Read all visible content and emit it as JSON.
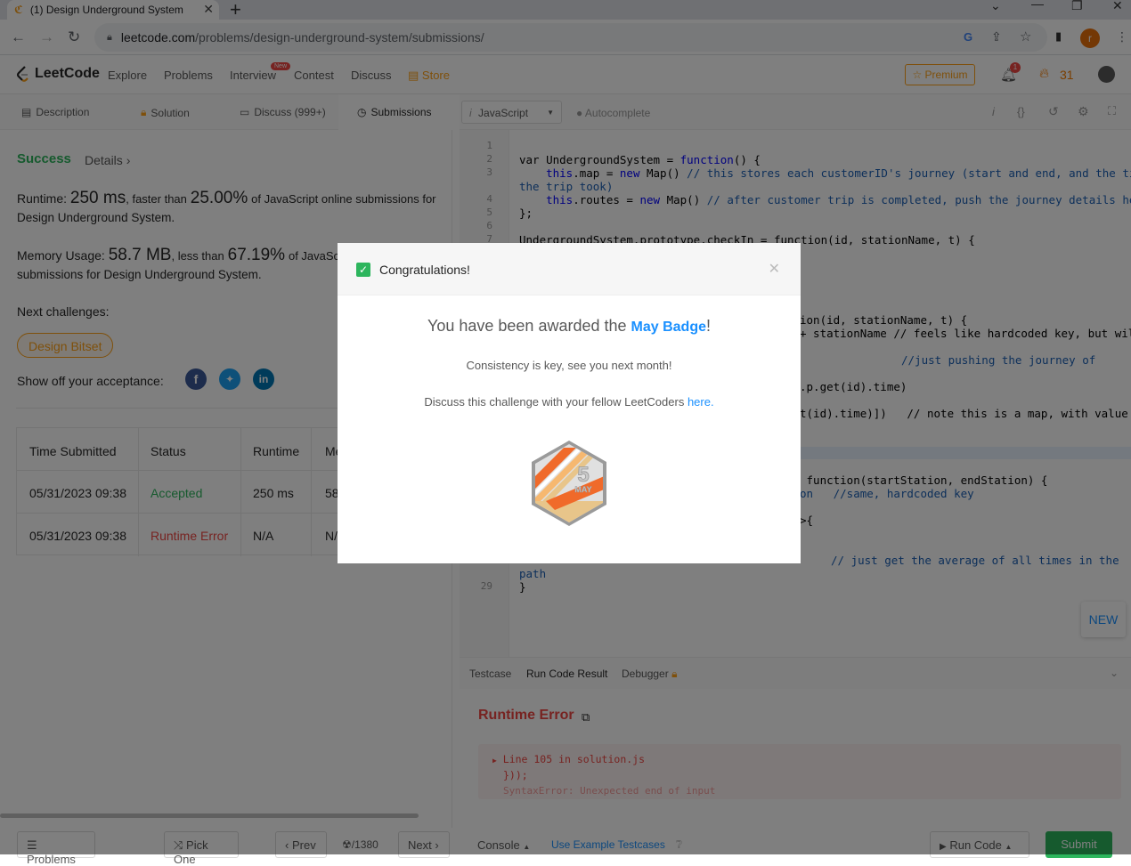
{
  "browser": {
    "tab_title": "(1) Design Underground System",
    "url_host": "leetcode.com",
    "url_path": "/problems/design-underground-system/submissions/",
    "profile_initial": "r"
  },
  "nav": {
    "logo": "LeetCode",
    "links": [
      "Explore",
      "Problems",
      "Interview",
      "Contest",
      "Discuss",
      "Store"
    ],
    "new_badge": "New",
    "premium": "Premium",
    "notif_count": "1",
    "streak": "31"
  },
  "left": {
    "tabs": [
      "Description",
      "Solution",
      "Discuss (999+)",
      "Submissions"
    ],
    "status": "Success",
    "details": "Details",
    "runtime_label": "Runtime:",
    "runtime_value": "250 ms",
    "runtime_mid": ", faster than",
    "runtime_pct": "25.00%",
    "runtime_tail": "of JavaScript online submissions for",
    "runtime_line2": "Design Underground System.",
    "memory_label": "Memory Usage:",
    "memory_value": "58.7 MB",
    "memory_mid": ", less than",
    "memory_pct": "67.19%",
    "memory_tail": "of JavaSc",
    "memory_line2": "submissions for Design Underground System.",
    "next_label": "Next challenges:",
    "next_tag": "Design Bitset",
    "share_label": "Show off your acceptance:",
    "table_headers": [
      "Time Submitted",
      "Status",
      "Runtime",
      "Me"
    ],
    "rows": [
      {
        "time": "05/31/2023 09:38",
        "status": "Accepted",
        "runtime": "250 ms",
        "mem": "58"
      },
      {
        "time": "05/31/2023 09:38",
        "status": "Runtime Error",
        "runtime": "N/A",
        "mem": "N/"
      }
    ]
  },
  "editor": {
    "language": "JavaScript",
    "autocomplete": "Autocomplete",
    "line_numbers": [
      "1",
      "2",
      "3",
      "",
      "4",
      "5",
      "6",
      "7",
      "29"
    ],
    "code": {
      "l2a": "var UndergroundSystem = ",
      "l2b": "function",
      "l2c": "() {",
      "l3a": "    this",
      "l3b": ".map = ",
      "l3c": "new",
      "l3d": " Map() ",
      "l3e": "// this stores each customerID's journey (start and end, and the time",
      "l3f": "the trip took)",
      "l4a": "    this",
      "l4b": ".routes = ",
      "l4c": "new",
      "l4d": " Map() ",
      "l4e": "// after customer trip is completed, push the journey details here",
      "l5": "};",
      "l7": "UndergroundSystem.prototype.checkIn = function(id, stationName, t) {",
      "p1": "ion(id, stationName, t) {",
      "p2": "+ stationName // feels like hardcoded key, but will",
      "p3": "//just pushing the journey of",
      "p4": ".p.get(id).time)",
      "p5": "t(id).time)])   // note this is a map, with value",
      "p6": " function(startStation, endStation) {",
      "p7": "on   //same, hardcoded key",
      "p8": ">{",
      "p9": "// just get the average of all times in the",
      "p10": "path",
      "p11": "}"
    },
    "new_button": "NEW",
    "bottom_tabs": [
      "Testcase",
      "Run Code Result",
      "Debugger"
    ],
    "result_title": "Runtime Error",
    "error_lines": [
      "Line 105 in solution.js",
      "}));",
      "SyntaxError: Unexpected end of input"
    ]
  },
  "footer": {
    "problems": "Problems",
    "pick_one": "Pick One",
    "prev": "Prev",
    "count": "/1380",
    "next": "Next",
    "console": "Console",
    "use_example": "Use Example Testcases",
    "run_code": "Run Code",
    "submit": "Submit"
  },
  "modal": {
    "title": "Congratulations!",
    "award_pre": "You have been awarded the ",
    "award_badge": "May Badge",
    "award_post": "!",
    "consistency": "Consistency is key, see you next month!",
    "discuss_pre": "Discuss this challenge with your fellow LeetCoders ",
    "discuss_link": "here",
    "discuss_post": ".",
    "badge_number": "5",
    "badge_month": "MAY"
  }
}
